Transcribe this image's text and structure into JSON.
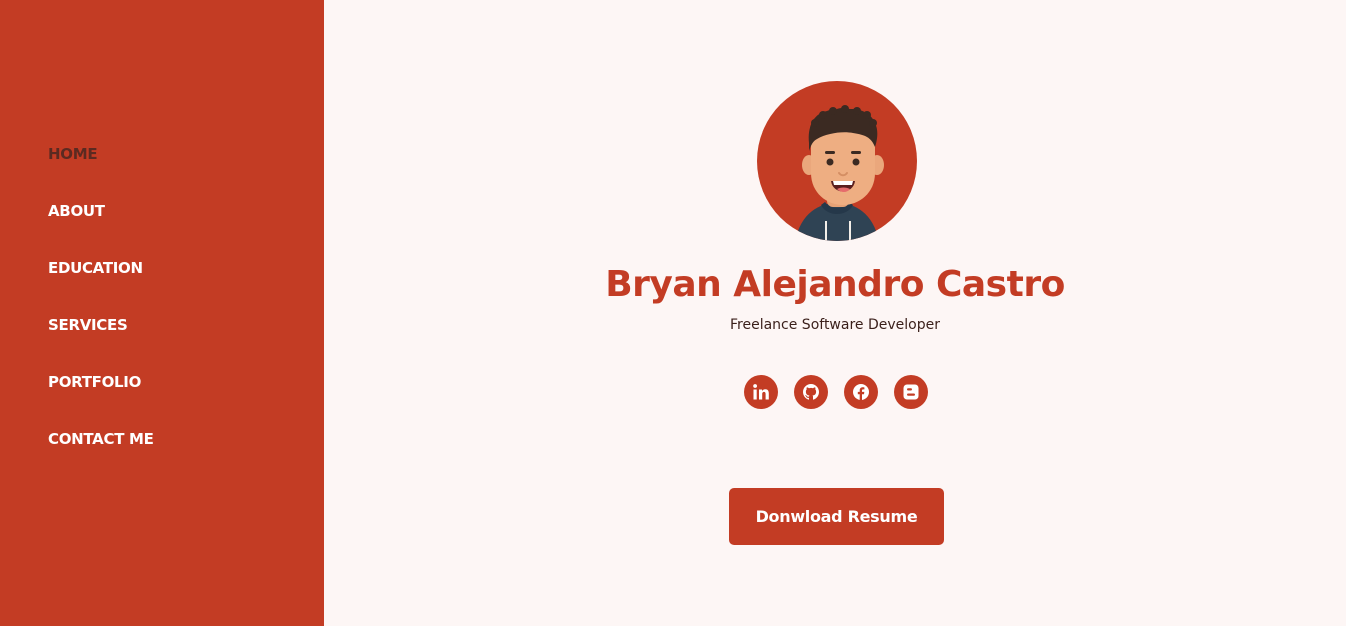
{
  "sidebar": {
    "items": [
      {
        "label": "HOME",
        "active": true
      },
      {
        "label": "ABOUT",
        "active": false
      },
      {
        "label": "EDUCATION",
        "active": false
      },
      {
        "label": "SERVICES",
        "active": false
      },
      {
        "label": "PORTFOLIO",
        "active": false
      },
      {
        "label": "CONTACT ME",
        "active": false
      }
    ]
  },
  "profile": {
    "avatar_icon": "cartoon-avatar",
    "name": "Bryan Alejandro Castro",
    "title": "Freelance Software Developer"
  },
  "socials": [
    {
      "icon": "linkedin-icon"
    },
    {
      "icon": "github-icon"
    },
    {
      "icon": "facebook-icon"
    },
    {
      "icon": "blogger-icon"
    }
  ],
  "cta": {
    "label": "Donwload Resume"
  },
  "colors": {
    "accent": "#c33c24",
    "background": "#fdf6f5",
    "nav_active": "#5b2a21",
    "text_dark": "#3a1f1a"
  }
}
